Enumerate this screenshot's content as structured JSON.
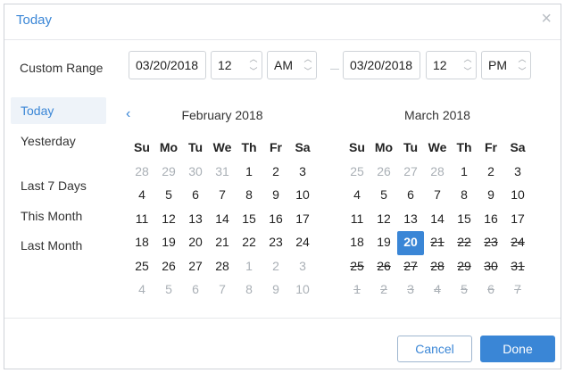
{
  "dialog": {
    "title": "Today",
    "close_label": "×"
  },
  "custom_range": {
    "label": "Custom Range",
    "start_date": "03/20/2018",
    "start_hour": "12",
    "start_period": "AM",
    "end_date": "03/20/2018",
    "end_hour": "12",
    "end_period": "PM"
  },
  "presets": [
    {
      "label": "Today",
      "active": true
    },
    {
      "label": "Yesterday",
      "active": false
    },
    {
      "label": "Last 7 Days",
      "active": false
    },
    {
      "label": "This Month",
      "active": false
    },
    {
      "label": "Last Month",
      "active": false
    }
  ],
  "weekdays": [
    "Su",
    "Mo",
    "Tu",
    "We",
    "Th",
    "Fr",
    "Sa"
  ],
  "calendars": [
    {
      "title": "February 2018",
      "has_prev": true,
      "weeks": [
        [
          [
            "28",
            "m"
          ],
          [
            "29",
            "m"
          ],
          [
            "30",
            "m"
          ],
          [
            "31",
            "m"
          ],
          [
            "1",
            ""
          ],
          [
            "2",
            ""
          ],
          [
            "3",
            ""
          ]
        ],
        [
          [
            "4",
            ""
          ],
          [
            "5",
            ""
          ],
          [
            "6",
            ""
          ],
          [
            "7",
            ""
          ],
          [
            "8",
            ""
          ],
          [
            "9",
            ""
          ],
          [
            "10",
            ""
          ]
        ],
        [
          [
            "11",
            ""
          ],
          [
            "12",
            ""
          ],
          [
            "13",
            ""
          ],
          [
            "14",
            ""
          ],
          [
            "15",
            ""
          ],
          [
            "16",
            ""
          ],
          [
            "17",
            ""
          ]
        ],
        [
          [
            "18",
            ""
          ],
          [
            "19",
            ""
          ],
          [
            "20",
            ""
          ],
          [
            "21",
            ""
          ],
          [
            "22",
            ""
          ],
          [
            "23",
            ""
          ],
          [
            "24",
            ""
          ]
        ],
        [
          [
            "25",
            ""
          ],
          [
            "26",
            ""
          ],
          [
            "27",
            ""
          ],
          [
            "28",
            ""
          ],
          [
            "1",
            "m"
          ],
          [
            "2",
            "m"
          ],
          [
            "3",
            "m"
          ]
        ],
        [
          [
            "4",
            "m"
          ],
          [
            "5",
            "m"
          ],
          [
            "6",
            "m"
          ],
          [
            "7",
            "m"
          ],
          [
            "8",
            "m"
          ],
          [
            "9",
            "m"
          ],
          [
            "10",
            "m"
          ]
        ]
      ]
    },
    {
      "title": "March 2018",
      "has_prev": false,
      "weeks": [
        [
          [
            "25",
            "m"
          ],
          [
            "26",
            "m"
          ],
          [
            "27",
            "m"
          ],
          [
            "28",
            "m"
          ],
          [
            "1",
            ""
          ],
          [
            "2",
            ""
          ],
          [
            "3",
            ""
          ]
        ],
        [
          [
            "4",
            ""
          ],
          [
            "5",
            ""
          ],
          [
            "6",
            ""
          ],
          [
            "7",
            ""
          ],
          [
            "8",
            ""
          ],
          [
            "9",
            ""
          ],
          [
            "10",
            ""
          ]
        ],
        [
          [
            "11",
            ""
          ],
          [
            "12",
            ""
          ],
          [
            "13",
            ""
          ],
          [
            "14",
            ""
          ],
          [
            "15",
            ""
          ],
          [
            "16",
            ""
          ],
          [
            "17",
            ""
          ]
        ],
        [
          [
            "18",
            ""
          ],
          [
            "19",
            ""
          ],
          [
            "20",
            "sel"
          ],
          [
            "21",
            "x"
          ],
          [
            "22",
            "x"
          ],
          [
            "23",
            "x"
          ],
          [
            "24",
            "x"
          ]
        ],
        [
          [
            "25",
            "x"
          ],
          [
            "26",
            "x"
          ],
          [
            "27",
            "x"
          ],
          [
            "28",
            "x"
          ],
          [
            "29",
            "x"
          ],
          [
            "30",
            "x"
          ],
          [
            "31",
            "x"
          ]
        ],
        [
          [
            "1",
            "mx"
          ],
          [
            "2",
            "mx"
          ],
          [
            "3",
            "mx"
          ],
          [
            "4",
            "mx"
          ],
          [
            "5",
            "mx"
          ],
          [
            "6",
            "mx"
          ],
          [
            "7",
            "mx"
          ]
        ]
      ]
    }
  ],
  "footer": {
    "cancel_label": "Cancel",
    "done_label": "Done"
  },
  "colors": {
    "accent": "#3a86d6",
    "muted_text": "#aab0b6"
  },
  "icons": {
    "close": "close-icon",
    "prev": "chevron-left-icon",
    "spinner": "up-down-spinner-icon"
  }
}
